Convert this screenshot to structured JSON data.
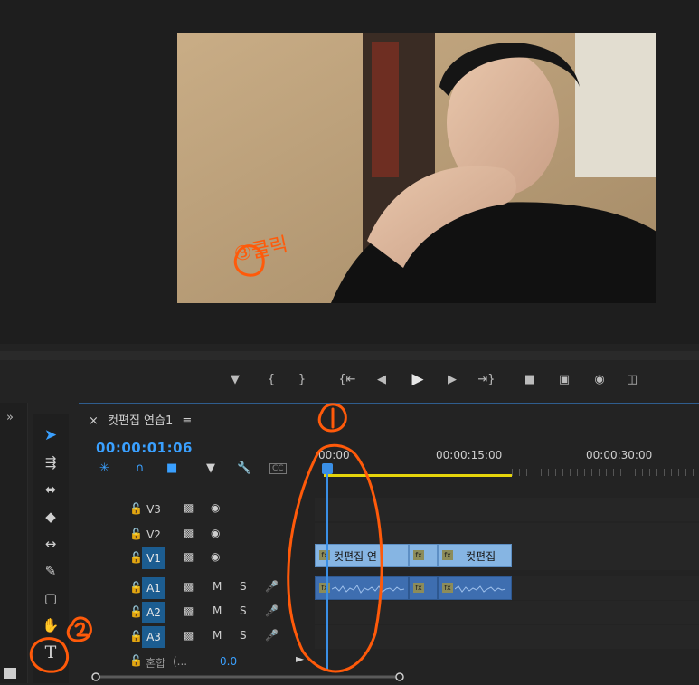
{
  "video_caption": "③클릭",
  "transport": {
    "icons": [
      "marker-icon",
      "mark-in-icon",
      "mark-out-icon",
      "go-to-in-icon",
      "step-back-icon",
      "play-icon",
      "step-forward-icon",
      "go-to-out-icon",
      "lift-icon",
      "extract-icon",
      "export-frame-icon",
      "button-editor-icon"
    ]
  },
  "left_panel": {
    "expand": "»"
  },
  "tools": [
    "selection-tool",
    "track-select-tool",
    "ripple-edit-tool",
    "razor-tool",
    "slip-tool",
    "pen-tool",
    "rectangle-tool",
    "hand-tool",
    "type-tool"
  ],
  "sequence": {
    "close": "×",
    "name": "컷편집 연습1",
    "menu": "≡",
    "timecode": "00:00:01:06",
    "ruler": [
      "00:00",
      "00:00:15:00",
      "00:00:30:00"
    ],
    "header_icons": [
      "snap-icon",
      "link-icon",
      "add-marker-icon",
      "marker-icon",
      "wrench-icon",
      "captions-icon"
    ],
    "tracks": [
      {
        "label": "V3",
        "type": "video",
        "on": false
      },
      {
        "label": "V2",
        "type": "video",
        "on": false
      },
      {
        "label": "V1",
        "type": "video",
        "on": true
      },
      {
        "label": "A1",
        "type": "audio",
        "on": true
      },
      {
        "label": "A2",
        "type": "audio",
        "on": true
      },
      {
        "label": "A3",
        "type": "audio",
        "on": true
      }
    ],
    "mix_label": "혼합",
    "mix_suffix": "(...",
    "mix_value": "0.0",
    "m_label": "M",
    "s_label": "S",
    "cc_label": "CC",
    "clips_v1": [
      {
        "label": "컷편집 연"
      },
      {
        "label": ""
      },
      {
        "label": "컷편집"
      }
    ]
  },
  "annotations": [
    "1",
    "2",
    "3"
  ],
  "colors": {
    "accent": "#3aa0ff",
    "annotation": "#ff5a0a",
    "workarea": "#e5d40b",
    "video_clip": "#86b5e3",
    "audio_clip": "#3e6eb0"
  }
}
